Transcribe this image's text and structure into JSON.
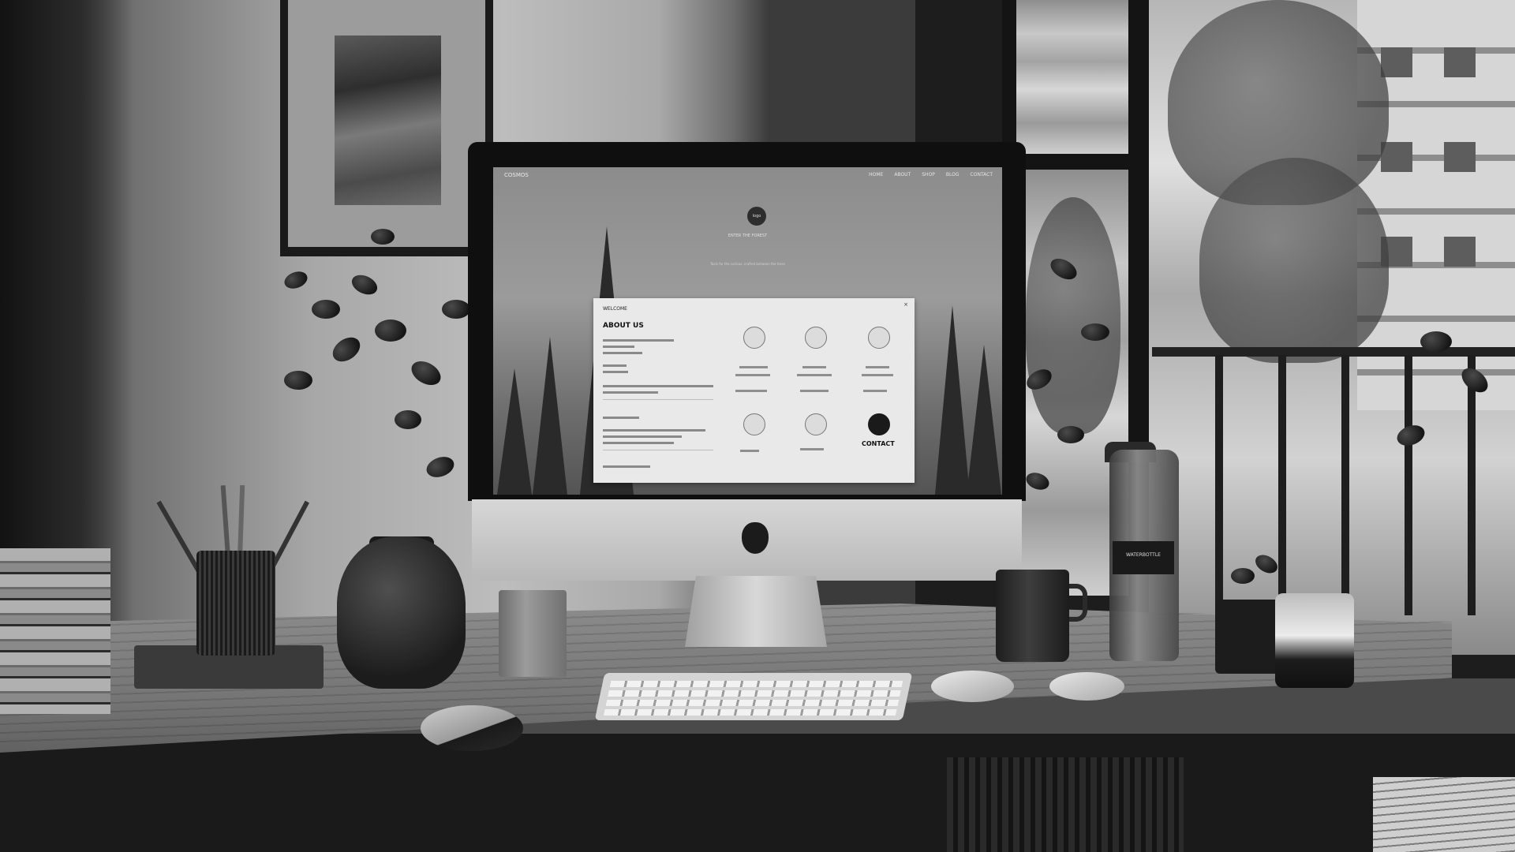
{
  "monitor_screen": {
    "site_logo": "COSMOS",
    "nav_items": [
      "HOME",
      "ABOUT",
      "SHOP",
      "BLOG",
      "CONTACT"
    ],
    "emblem_text": "logo",
    "tagline": "ENTER THE FOREST",
    "strapline": "Tools for the curious, crafted between the trees",
    "modal": {
      "heading": "WELCOME",
      "title": "ABOUT US",
      "close_symbol": "×",
      "card_word": "CONTACT"
    }
  },
  "bottle": {
    "label": "WATERBOTTLE"
  },
  "colors": {
    "wall": "#bdbdbd",
    "desk": "#7a7a7a",
    "bezel": "#0f0f0f",
    "aluminum": "#cfcfcf",
    "window_frame": "#1d1d1d"
  }
}
